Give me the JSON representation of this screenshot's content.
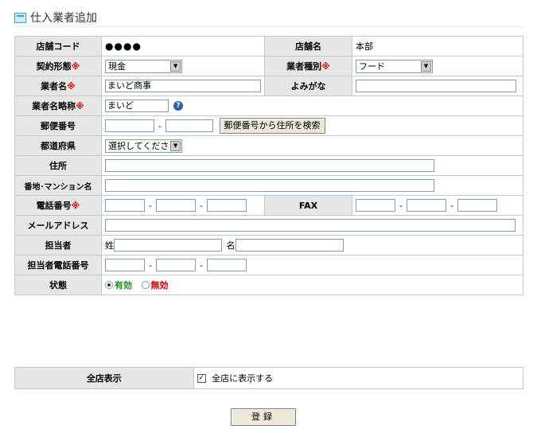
{
  "page": {
    "title": "仕入業者追加"
  },
  "form": {
    "store_code": {
      "label": "店舗コード",
      "value": "●●●●"
    },
    "store_name": {
      "label": "店舗名",
      "value": "本部"
    },
    "contract": {
      "label": "契約形態",
      "req": "※",
      "value": "現金"
    },
    "vendor_type": {
      "label": "業者種別",
      "req": "※",
      "value": "フード"
    },
    "vendor_name": {
      "label": "業者名",
      "req": "※",
      "value": "まいど商事"
    },
    "reading": {
      "label": "よみがな",
      "value": ""
    },
    "short_name": {
      "label": "業者名略称",
      "req": "※",
      "value": "まいど",
      "help": "?"
    },
    "postal": {
      "label": "郵便番号",
      "value1": "",
      "value2": "",
      "button": "郵便番号から住所を検索",
      "sep": "-"
    },
    "prefecture": {
      "label": "都道府県",
      "value": "選択してください"
    },
    "address": {
      "label": "住所",
      "value": ""
    },
    "building": {
      "label": "番地･マンション名",
      "value": ""
    },
    "phone": {
      "label": "電話番号",
      "req": "※",
      "sep": "-"
    },
    "fax": {
      "label": "FAX",
      "sep": "-"
    },
    "email": {
      "label": "メールアドレス",
      "value": ""
    },
    "person": {
      "label": "担当者",
      "last_label": "姓",
      "first_label": "名"
    },
    "person_phone": {
      "label": "担当者電話番号",
      "sep": "-"
    },
    "status": {
      "label": "状態",
      "active": "有効",
      "inactive": "無効",
      "selected": "有効"
    }
  },
  "show_all": {
    "label": "全店表示",
    "checkbox_label": "全店に表示する",
    "checked": true,
    "check_glyph": "✓"
  },
  "submit_label": "登録",
  "colors": {
    "label_bg": "#e6e6e6",
    "border": "#c8c8c8",
    "required": "#dd0000",
    "active": "#1a8a1a",
    "inactive": "#cc0000"
  }
}
